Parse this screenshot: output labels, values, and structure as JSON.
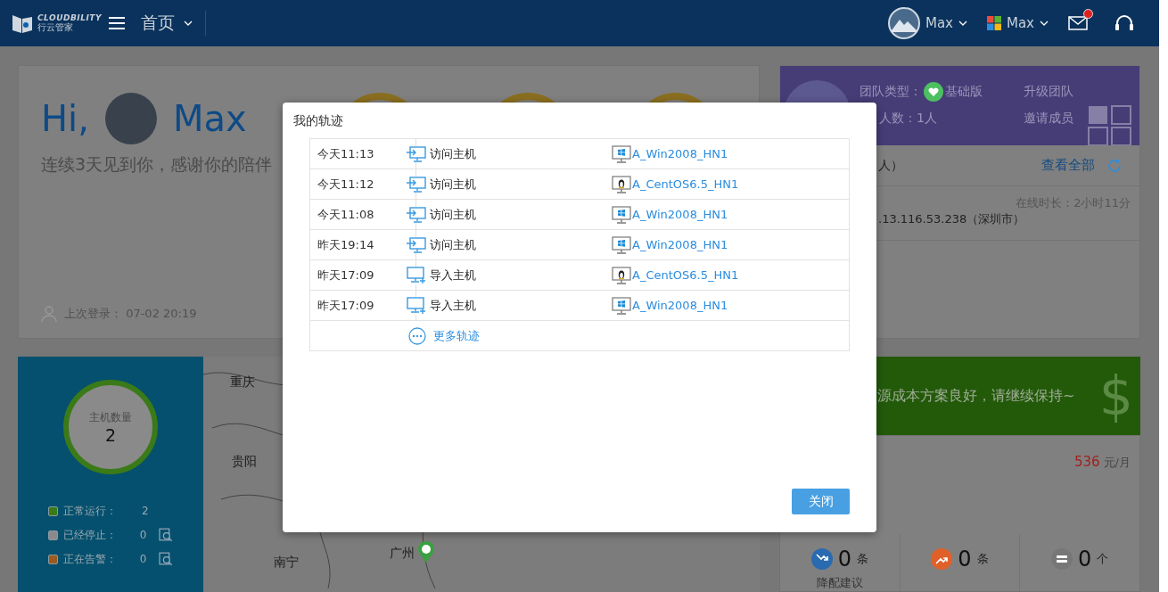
{
  "topbar": {
    "logo_text": "CLOUDBILITY",
    "logo_subtext": "行云管家",
    "nav": "首页",
    "user": "Max",
    "team": "Max",
    "mail_unread": true
  },
  "welcome": {
    "greeting": "Hi,",
    "name": "Max",
    "message": "连续3天见到你，感谢你的陪伴",
    "last_login": "上次登录： 07-02 20:19"
  },
  "team": {
    "type_label": "团队类型：",
    "type": "基础版",
    "upgrade": "升级团队",
    "members": "人数：1人",
    "invite": "邀请成员",
    "online_header": "人）",
    "view_all": "查看全部",
    "online_time": "在线时长：2小时11分",
    "ip": ".13.116.53.238（深圳市）"
  },
  "hosts": {
    "title": "主机数量",
    "count": "2",
    "statuses": [
      {
        "label": "正常运行：",
        "value": "2",
        "color": "#3a7a18",
        "has_search": false
      },
      {
        "label": "已经停止：",
        "value": "0",
        "color": "#8a8a8a",
        "has_search": true
      },
      {
        "label": "正在告警：",
        "value": "0",
        "color": "#9a5a20",
        "has_search": true
      }
    ]
  },
  "map": {
    "cities": [
      {
        "name": "重庆"
      },
      {
        "name": "贵阳"
      },
      {
        "name": "南宁"
      },
      {
        "name": "广州"
      }
    ]
  },
  "cost": {
    "banner": "源成本方案良好，请继续保持~",
    "banner_icon": "$",
    "amount": "536",
    "unit": "元/月",
    "stats": [
      {
        "kind": "down",
        "value": "0",
        "unit": "条",
        "label": "降配建议"
      },
      {
        "kind": "up",
        "value": "0",
        "unit": "条"
      },
      {
        "kind": "disk",
        "value": "0",
        "unit": "个"
      }
    ]
  },
  "dialog": {
    "title": "我的轨迹",
    "rows": [
      {
        "time": "今天11:13",
        "action": {
          "kind": "visit",
          "label": "访问主机"
        },
        "host": {
          "kind": "windows",
          "name": "A_Win2008_HN1"
        }
      },
      {
        "time": "今天11:12",
        "action": {
          "kind": "visit",
          "label": "访问主机"
        },
        "host": {
          "kind": "linux",
          "name": "A_CentOS6.5_HN1"
        }
      },
      {
        "time": "今天11:08",
        "action": {
          "kind": "visit",
          "label": "访问主机"
        },
        "host": {
          "kind": "windows",
          "name": "A_Win2008_HN1"
        }
      },
      {
        "time": "昨天19:14",
        "action": {
          "kind": "visit",
          "label": "访问主机"
        },
        "host": {
          "kind": "windows",
          "name": "A_Win2008_HN1"
        }
      },
      {
        "time": "昨天17:09",
        "action": {
          "kind": "import",
          "label": "导入主机"
        },
        "host": {
          "kind": "linux",
          "name": "A_CentOS6.5_HN1"
        }
      },
      {
        "time": "昨天17:09",
        "action": {
          "kind": "import",
          "label": "导入主机"
        },
        "host": {
          "kind": "windows",
          "name": "A_Win2008_HN1"
        }
      }
    ],
    "more": "更多轨迹",
    "close": "关闭"
  }
}
